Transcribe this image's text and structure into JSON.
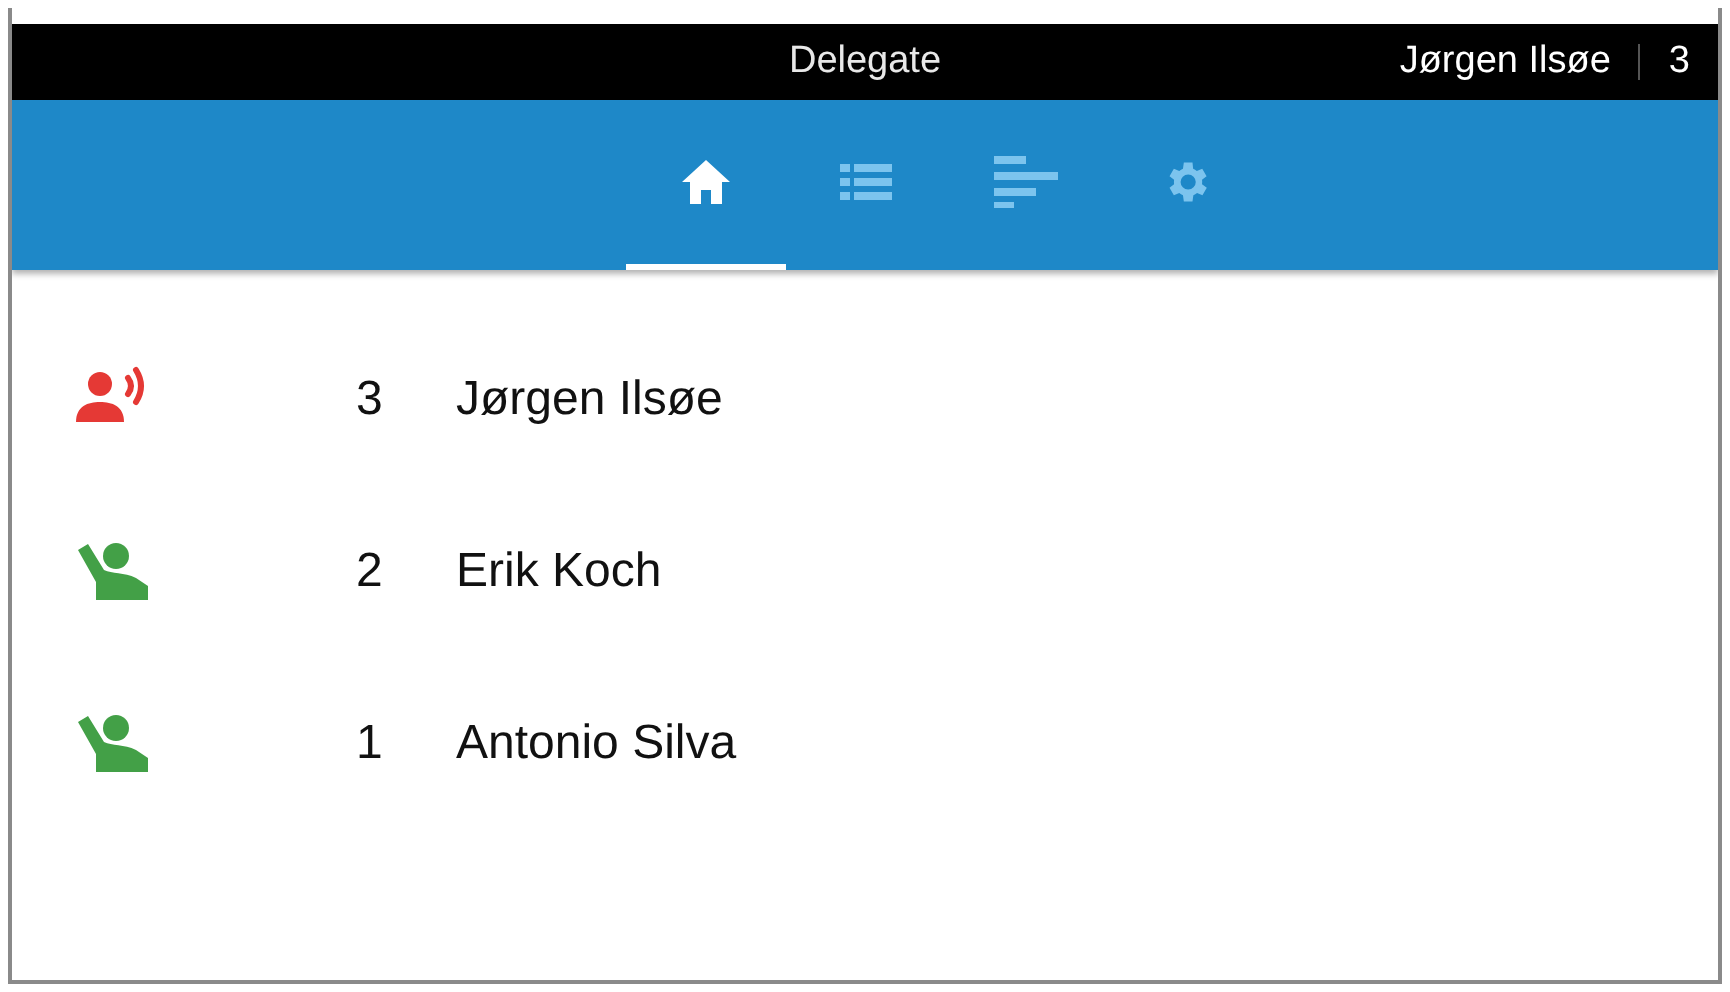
{
  "header": {
    "title": "Delegate",
    "user": "Jørgen Ilsøe",
    "seat": "3"
  },
  "tabs": [
    {
      "kind": "home",
      "selected": true
    },
    {
      "kind": "list",
      "selected": false
    },
    {
      "kind": "bars",
      "selected": false
    },
    {
      "kind": "settings",
      "selected": false
    }
  ],
  "speakers": [
    {
      "kind": "speaking",
      "color": "#e53935",
      "seat": "3",
      "name": "Jørgen Ilsøe"
    },
    {
      "kind": "request",
      "color": "#43a047",
      "seat": "2",
      "name": "Erik Koch"
    },
    {
      "kind": "request",
      "color": "#43a047",
      "seat": "1",
      "name": "Antonio Silva"
    }
  ]
}
